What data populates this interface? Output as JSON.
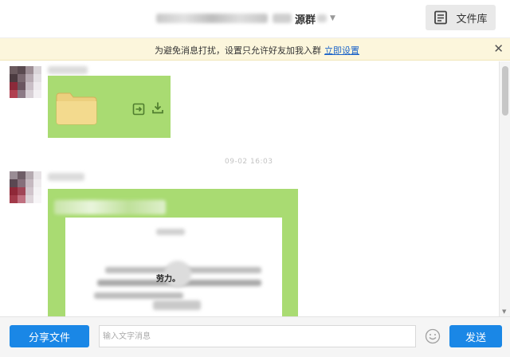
{
  "header": {
    "group_title": "源群",
    "file_library_label": "文件库"
  },
  "notice": {
    "text": "为避免消息打扰，设置只允许好友加我入群",
    "link_label": "立即设置",
    "close_glyph": "✕"
  },
  "chat": {
    "timestamp": "09-02 16:03",
    "doc_tail_text": "劳力。"
  },
  "footer": {
    "share_label": "分享文件",
    "input_placeholder": "输入文字消息",
    "send_label": "发送"
  },
  "icons": {
    "file_library": "file-library-icon",
    "forward": "forward-icon",
    "download": "download-icon",
    "folder": "folder-icon",
    "emoji": "emoji-icon",
    "close": "close-icon"
  },
  "colors": {
    "accent": "#1a87e6",
    "bubble": "#a9db72",
    "notice_bg": "#fcf6dc",
    "link": "#1a63c9"
  }
}
